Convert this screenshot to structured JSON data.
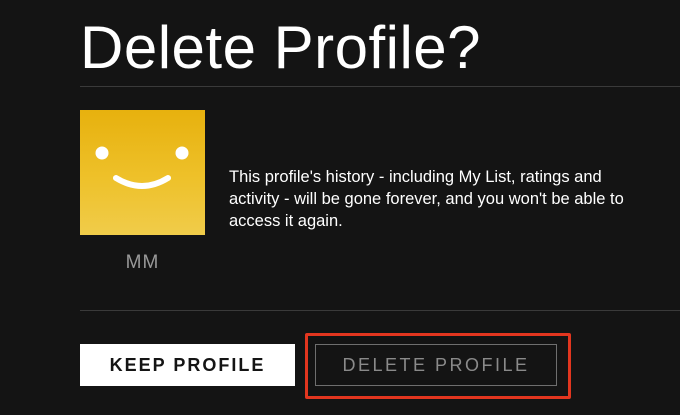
{
  "page": {
    "title": "Delete Profile?"
  },
  "profile": {
    "name": "MM",
    "avatar_color": "#eab818",
    "avatar_icon": "smiley-face-icon"
  },
  "message": "This profile's history - including My List, ratings and activity - will be gone forever, and you won't be able to access it again.",
  "buttons": {
    "keep_label": "KEEP PROFILE",
    "delete_label": "DELETE PROFILE"
  },
  "colors": {
    "background": "#141414",
    "highlight": "#e2361f",
    "divider": "#3a3a3a"
  }
}
